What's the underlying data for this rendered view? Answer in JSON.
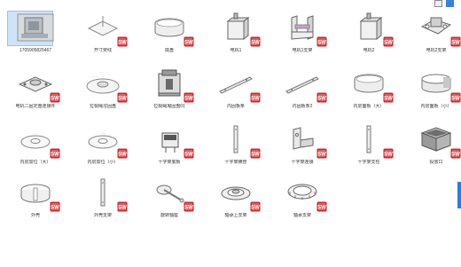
{
  "colors": {
    "accent": "#3d7fd6",
    "badge_red": "#d3262a",
    "selection": "#cfe3f7"
  },
  "toolbar": {
    "icons": [
      "details-view-icon",
      "large-icons-view-icon"
    ]
  },
  "files": [
    {
      "label": "1705905825467",
      "icon": "photo-thumbnail",
      "selected": true
    },
    {
      "label": "开寸荧线",
      "icon": "flat-plate"
    },
    {
      "label": "底盘",
      "icon": "ring-band"
    },
    {
      "label": "电机1",
      "icon": "motor-block"
    },
    {
      "label": "电机1支架",
      "icon": "u-bracket"
    },
    {
      "label": "电机2",
      "icon": "motor-block"
    },
    {
      "label": "电机2支架",
      "icon": "bracket-assembly"
    },
    {
      "label": "电机二固定盘连接件",
      "icon": "square-plate"
    },
    {
      "label": "拉裂绳溶固盘",
      "icon": "disc-with-notes"
    },
    {
      "label": "拉裂绳凝固盘01",
      "icon": "motor-assembly"
    },
    {
      "label": "内固板条",
      "icon": "flat-bar"
    },
    {
      "label": "内固板条2",
      "icon": "flat-bar"
    },
    {
      "label": "内层面板（大）",
      "icon": "ring-band"
    },
    {
      "label": "内层面板（小）",
      "icon": "ring-band-open"
    },
    {
      "label": "内层加位（大）",
      "icon": "disc-plate"
    },
    {
      "label": "内层加位（小）",
      "icon": "disc-plate"
    },
    {
      "label": "十字架底板",
      "icon": "cross-base"
    },
    {
      "label": "十字架横管",
      "icon": "thin-rod"
    },
    {
      "label": "十字架连接",
      "icon": "corner-bracket"
    },
    {
      "label": "十字架支柱",
      "icon": "thin-rod"
    },
    {
      "label": "投放口",
      "icon": "box-open"
    },
    {
      "label": "外壳",
      "icon": "shell-ring"
    },
    {
      "label": "外壳支架",
      "icon": "thin-rod"
    },
    {
      "label": "旋转轴座",
      "icon": "rotary-arm"
    },
    {
      "label": "轴承上支架",
      "icon": "bearing-disc"
    },
    {
      "label": "轴承支架",
      "icon": "bearing-ring"
    }
  ]
}
